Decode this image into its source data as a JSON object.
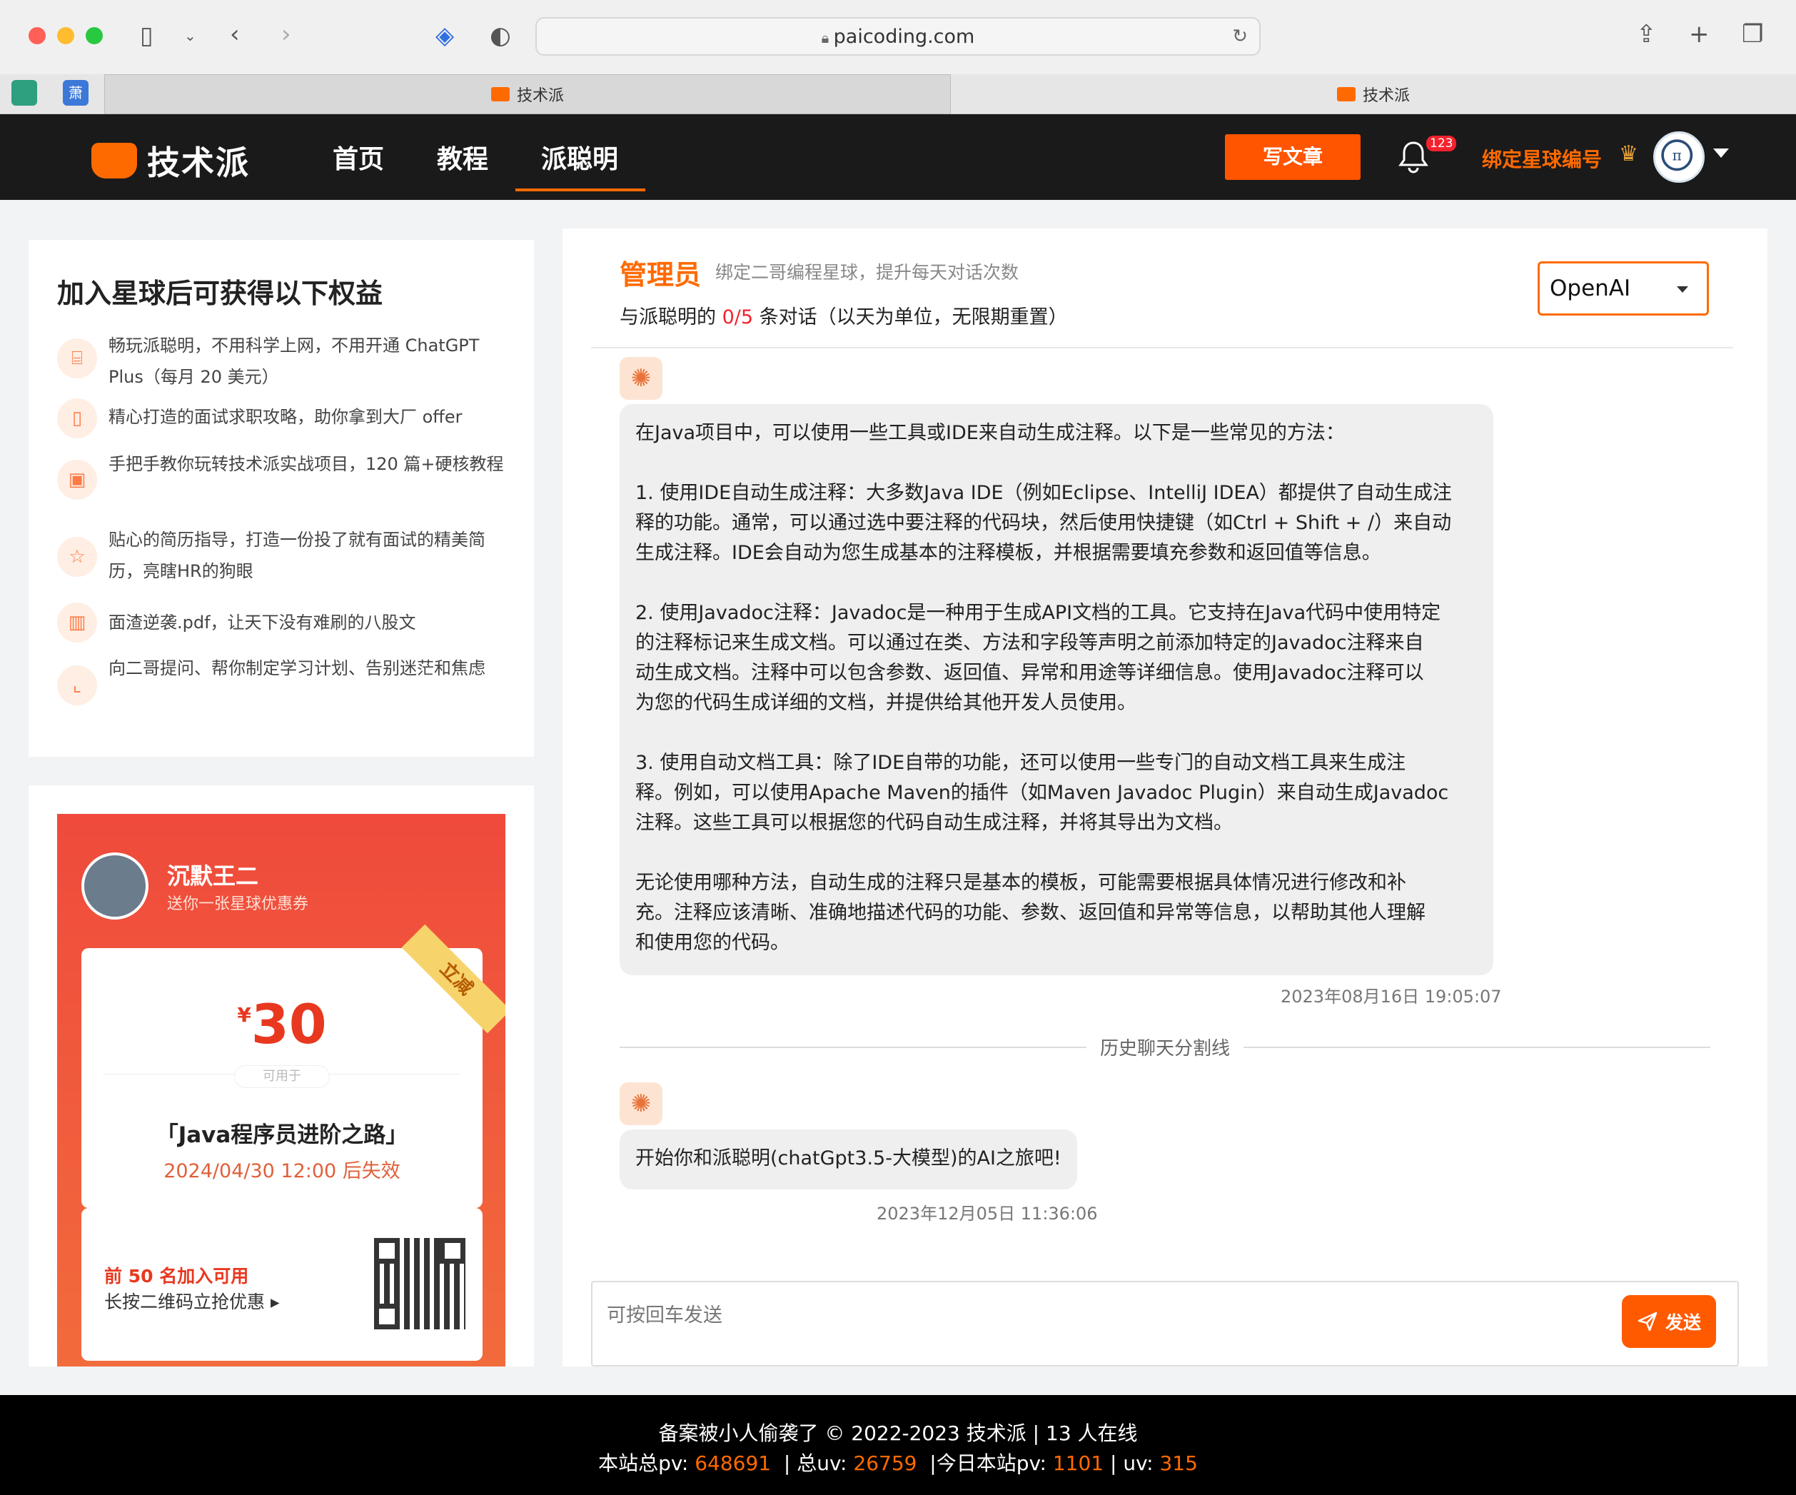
{
  "browser": {
    "url": "paicoding.com",
    "tabs": [
      {
        "label": "技术派"
      },
      {
        "label": "技术派"
      }
    ],
    "pinned_tab_2": "萧"
  },
  "header": {
    "logo_text": "技术派",
    "nav": [
      {
        "label": "首页"
      },
      {
        "label": "教程"
      },
      {
        "label": "派聪明"
      }
    ],
    "write_button": "写文章",
    "notification_count": "123",
    "bind_star_label": "绑定星球编号"
  },
  "benefits": {
    "title": "加入星球后可获得以下权益",
    "items": [
      {
        "icon": "gift-icon",
        "text": "畅玩派聪明，不用科学上网，不用开通 ChatGPT Plus（每月 20 美元）"
      },
      {
        "icon": "book-icon",
        "text": "精心打造的面试求职攻略，助你拿到大厂 offer"
      },
      {
        "icon": "project-icon",
        "text": "手把手教你玩转技术派实战项目，120 篇+硬核教程"
      },
      {
        "icon": "star-icon",
        "text": "贴心的简历指导，打造一份投了就有面试的精美简历，亮瞎HR的狗眼"
      },
      {
        "icon": "library-icon",
        "text": "面渣逆袭.pdf，让天下没有难刷的八股文"
      },
      {
        "icon": "chart-icon",
        "text": "向二哥提问、帮你制定学习计划、告别迷茫和焦虑"
      }
    ]
  },
  "coupon": {
    "name": "沉默王二",
    "subtitle": "送你一张星球优惠券",
    "ribbon": "立减",
    "currency": "¥",
    "amount": "30",
    "usable_for": "可用于",
    "course": "「Java程序员进阶之路」",
    "expire": "2024/04/30 12:00 后失效",
    "first_n": "前 50 名加入可用",
    "press_qr": "长按二维码立抢优惠 ▸"
  },
  "chat": {
    "admin_label": "管理员",
    "admin_sub": "绑定二哥编程星球，提升每天对话次数",
    "quota_prefix": "与派聪明的 ",
    "quota_value": "0/5",
    "quota_suffix": " 条对话（以天为单位，无限期重置）",
    "model": "OpenAI",
    "messages": [
      {
        "lines": [
          "在Java项目中，可以使用一些工具或IDE来自动生成注释。以下是一些常见的方法：",
          "",
          "1. 使用IDE自动生成注释：大多数Java IDE（例如Eclipse、IntelliJ IDEA）都提供了自动生成注",
          "释的功能。通常，可以通过选中要注释的代码块，然后使用快捷键（如Ctrl + Shift + /）来自动",
          "生成注释。IDE会自动为您生成基本的注释模板，并根据需要填充参数和返回值等信息。",
          "",
          "2. 使用Javadoc注释：Javadoc是一种用于生成API文档的工具。它支持在Java代码中使用特定",
          "的注释标记来生成文档。可以通过在类、方法和字段等声明之前添加特定的Javadoc注释来自",
          "动生成文档。注释中可以包含参数、返回值、异常和用途等详细信息。使用Javadoc注释可以",
          "为您的代码生成详细的文档，并提供给其他开发人员使用。",
          "",
          "3. 使用自动文档工具：除了IDE自带的功能，还可以使用一些专门的自动文档工具来生成注",
          "释。例如，可以使用Apache Maven的插件（如Maven Javadoc Plugin）来自动生成Javadoc",
          "注释。这些工具可以根据您的代码自动生成注释，并将其导出为文档。",
          "",
          "无论使用哪种方法，自动生成的注释只是基本的模板，可能需要根据具体情况进行修改和补",
          "充。注释应该清晰、准确地描述代码的功能、参数、返回值和异常等信息，以帮助其他人理解",
          "和使用您的代码。"
        ],
        "time": "2023年08月16日 19:05:07"
      },
      {
        "lines": [
          "开始你和派聪明(chatGpt3.5-大模型)的AI之旅吧!"
        ],
        "time": "2023年12月05日 11:36:06"
      }
    ],
    "history_divider": "历史聊天分割线",
    "input_placeholder": "可按回车发送",
    "send_label": "发送"
  },
  "footer": {
    "line1": "备案被小人偷袭了 © 2022-2023 技术派 | 13 人在线",
    "pv_label": "本站总pv: ",
    "pv": "648691",
    "uv_label": "  | 总uv: ",
    "uv": "26759",
    "today_pv_label": "  |今日本站pv: ",
    "today_pv": "1101",
    "today_uv_label": " | uv: ",
    "today_uv": "315"
  },
  "colors": {
    "accent": "#ff6a00",
    "nav_bg": "#1a1a1a",
    "danger": "#f5222d"
  }
}
